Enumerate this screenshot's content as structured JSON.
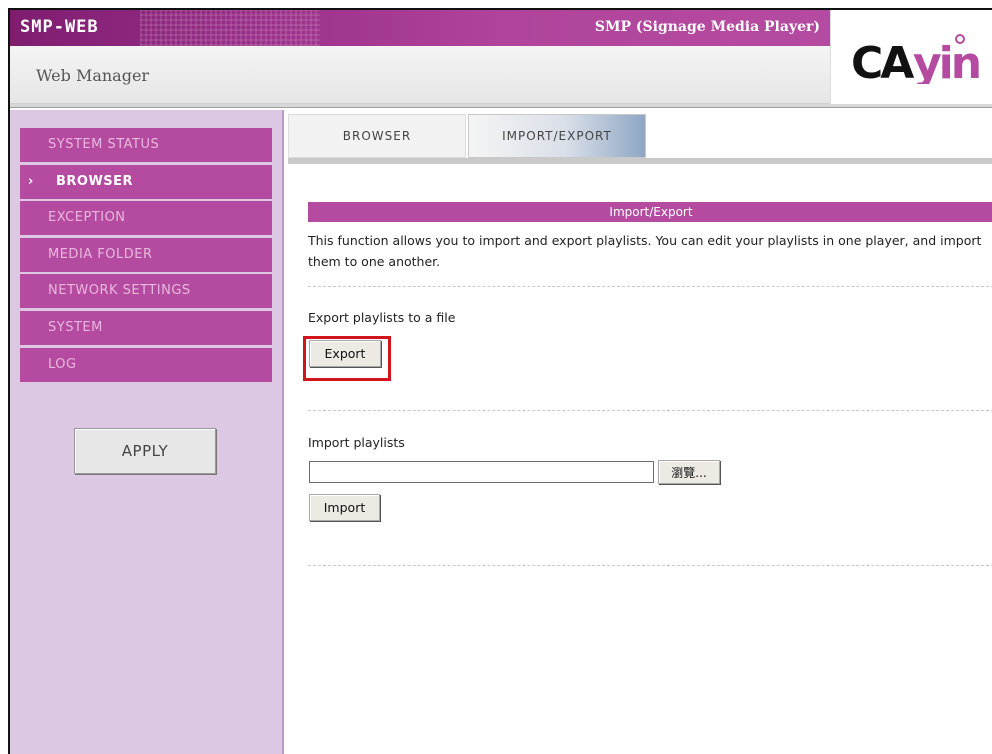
{
  "header": {
    "logo_text": "SMP-WEB",
    "product_title": "SMP (Signage Media Player)",
    "subtitle": "Web Manager",
    "brand": "CAYIN"
  },
  "sidebar": {
    "items": [
      {
        "label": "SYSTEM STATUS",
        "active": false
      },
      {
        "label": "BROWSER",
        "active": true
      },
      {
        "label": "EXCEPTION",
        "active": false
      },
      {
        "label": "MEDIA FOLDER",
        "active": false
      },
      {
        "label": "NETWORK SETTINGS",
        "active": false
      },
      {
        "label": "SYSTEM",
        "active": false
      },
      {
        "label": "LOG",
        "active": false
      }
    ],
    "active_marker": "›",
    "apply_label": "APPLY"
  },
  "tabs": [
    {
      "label": "BROWSER",
      "selected": false
    },
    {
      "label": "IMPORT/EXPORT",
      "selected": true
    }
  ],
  "panel": {
    "title": "Import/Export",
    "description": "This function allows you to import and export playlists. You can edit your playlists in one player, and import them to one another.",
    "export_label": "Export playlists to a file",
    "export_button": "Export",
    "import_label": "Import playlists",
    "file_value": "",
    "browse_button": "瀏覽...",
    "import_button": "Import"
  },
  "colors": {
    "brand_purple": "#b54ba0",
    "sidebar_bg": "#dcc8e3",
    "highlight_red": "#d2141c"
  }
}
